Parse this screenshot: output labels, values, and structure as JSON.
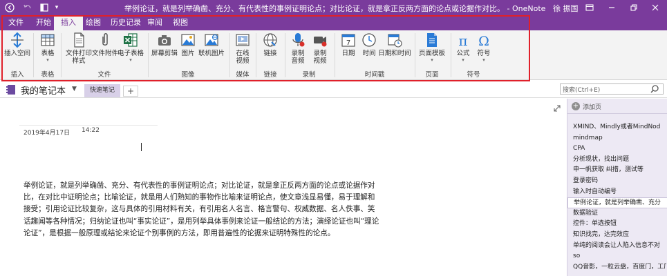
{
  "titlebar": {
    "title": "举例论证，就是列举确凿、充分、有代表性的事例证明论点；对比论证，就是拿正反两方面的论点或论据作对比。 - OneNote",
    "user": "徐 振国",
    "icons": [
      "back-icon",
      "forward-icon",
      "layout-icon",
      "dropdown-icon",
      "help-icon",
      "restore-icon",
      "minimize-icon",
      "maximize-icon",
      "close-icon"
    ]
  },
  "tabs": [
    "文件",
    "开始",
    "插入",
    "绘图",
    "历史记录",
    "审阅",
    "视图"
  ],
  "ribbon": {
    "buttons": {
      "insert_space": "插入空间",
      "table": "表格",
      "file_printout": "文件打印样式",
      "file_attach": "文件附件",
      "spreadsheet": "电子表格",
      "screen_clip": "屏幕剪辑",
      "picture": "图片",
      "online_picture": "联机图片",
      "online_video": "在线视频",
      "link": "链接",
      "record_audio": "录制音频",
      "record_video": "录制视频",
      "date": "日期",
      "time": "时间",
      "date_time": "日期和时间",
      "page_template": "页面模板",
      "equation": "公式",
      "symbol": "符号"
    },
    "groups": {
      "insert": "插入",
      "tables": "表格",
      "files": "文件",
      "images": "图像",
      "media": "媒体",
      "links": "链接",
      "recording": "录制",
      "timestamp": "时间戳",
      "pages": "页面",
      "symbols": "符号"
    }
  },
  "notebook": {
    "name": "我的笔记本",
    "section_tab": "快速笔记",
    "add_tab": "+",
    "search_placeholder": "搜索(Ctrl+E)"
  },
  "page": {
    "date": "2019年4月17日",
    "time": "14:22",
    "body": "举例论证，就是列举确凿、充分、有代表性的事例证明论点；对比论证，就是拿正反两方面的论点或论据作对比，在对比中证明论点；比喻论证，就是用人们熟知的事物作比喻来证明论点，使文章浅显易懂，易于理解和接受；引用论证比较复杂，这与具体的引用材料有关，有引用名人名言、格言警句、权威数据、名人佚事、笑话趣闻等各种情况；归纳论证也叫“事实论证”，是用列举具体事例来论证一般结论的方法；演绎论证也叫“理论论证”，是根据一般原理或结论来论证个别事例的方法，即用普遍性的论据来证明特殊性的论点。"
  },
  "pagelist": {
    "add_page": "添加页",
    "items": [
      "XMIND、Mindly或者MindNod",
      "mindmap",
      "CPA",
      "分析现状，找出问题",
      "申一帆获取 纠措，测试等",
      "登录密码",
      "输入时自动编号",
      "举例论证，就是列举确凿、充分",
      "数据验证",
      "控件：单选按钮",
      "知识找完，达完效应",
      "单纯的阅读会让人陷入信息不对",
      "so",
      "QQ音影，一粒云盘，百度门，工厂"
    ],
    "selected_index": 7
  },
  "colors": {
    "accent": "#7a3b9c",
    "ribbon_bg": "#f3f3f3",
    "highlight": "#e0202a",
    "pagelist_bg": "#ede9f4",
    "section_tab": "#d8d0e8"
  }
}
